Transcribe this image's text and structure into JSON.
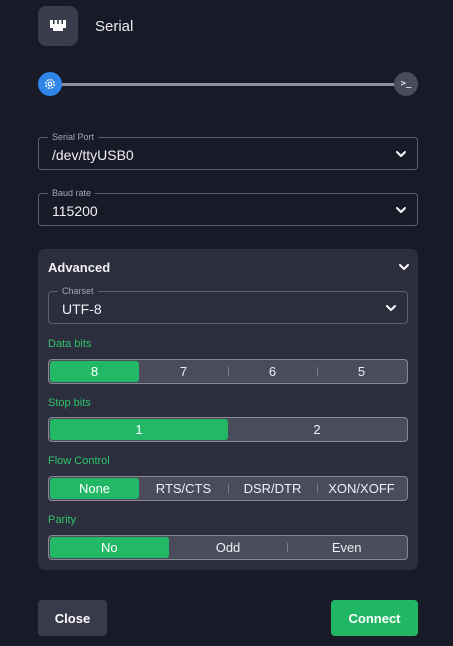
{
  "header": {
    "title": "Serial",
    "logo_icon": "ethernet-port-icon"
  },
  "stepper": {
    "current_icon": "settings-gear-icon",
    "next_label": ">_",
    "next_icon": "terminal-icon"
  },
  "serial_port": {
    "label": "Serial Port",
    "value": "/dev/ttyUSB0"
  },
  "baud_rate": {
    "label": "Baud rate",
    "value": "115200"
  },
  "advanced": {
    "title": "Advanced",
    "charset": {
      "label": "Charset",
      "value": "UTF-8"
    },
    "data_bits": {
      "label": "Data bits",
      "options": [
        "8",
        "7",
        "6",
        "5"
      ],
      "selected": "8"
    },
    "stop_bits": {
      "label": "Stop bits",
      "options": [
        "1",
        "2"
      ],
      "selected": "1"
    },
    "flow_control": {
      "label": "Flow Control",
      "options": [
        "None",
        "RTS/CTS",
        "DSR/DTR",
        "XON/XOFF"
      ],
      "selected": "None"
    },
    "parity": {
      "label": "Parity",
      "options": [
        "No",
        "Odd",
        "Even"
      ],
      "selected": "No"
    }
  },
  "footer": {
    "close_label": "Close",
    "connect_label": "Connect"
  },
  "colors": {
    "accent": "#22b865",
    "step_active": "#2f86e8",
    "background": "#191a27",
    "panel": "#2c2e3e"
  }
}
